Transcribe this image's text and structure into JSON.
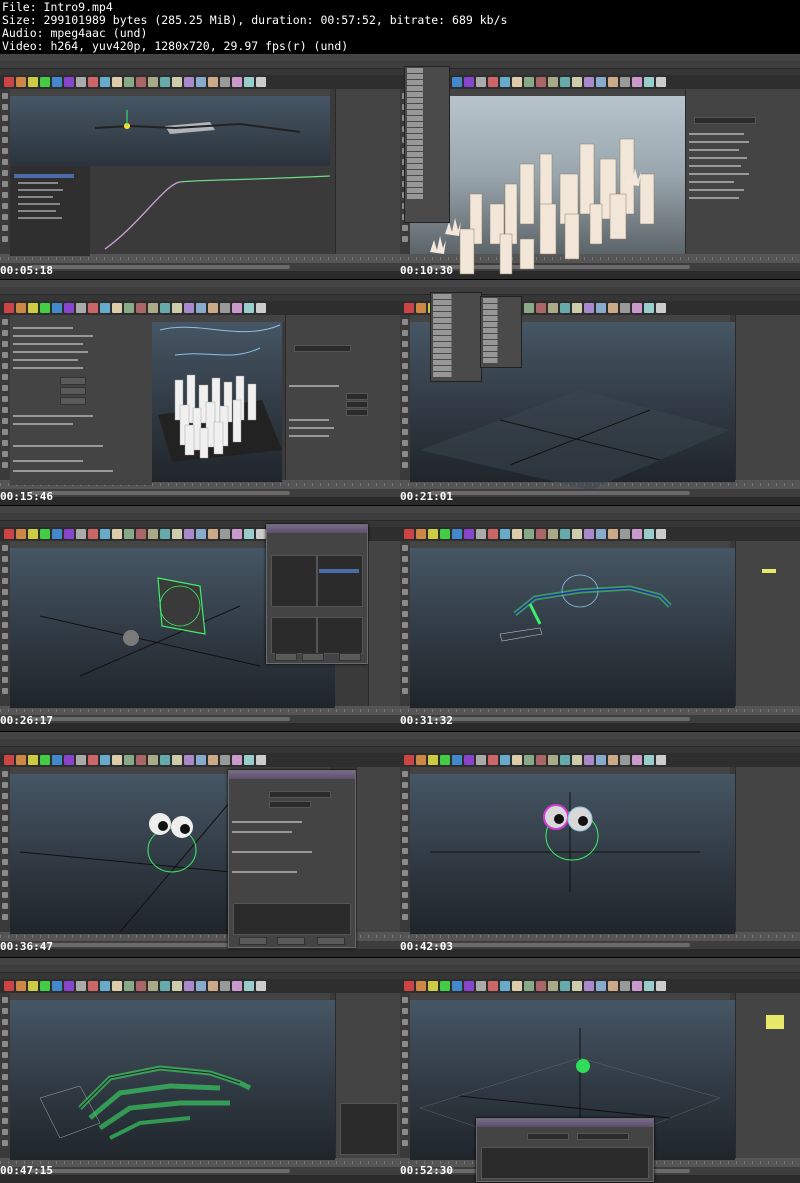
{
  "header": {
    "file": "File: Intro9.mp4",
    "size": "Size: 299101989 bytes (285.25 MiB), duration: 00:57:52, bitrate: 689 kb/s",
    "audio": "Audio: mpeg4aac (und)",
    "video": "Video: h264, yuv420p, 1280x720, 29.97 fps(r) (und)"
  },
  "thumbnails": [
    {
      "timestamp": "00:05:18",
      "scene": "graph-editor-curve"
    },
    {
      "timestamp": "00:10:30",
      "scene": "city-buildings-outliner-menu"
    },
    {
      "timestamp": "00:15:46",
      "scene": "city-motion-path-settings"
    },
    {
      "timestamp": "00:21:01",
      "scene": "create-menu-empty-grid"
    },
    {
      "timestamp": "00:26:17",
      "scene": "plane-sphere-connection-editor"
    },
    {
      "timestamp": "00:31:32",
      "scene": "rigged-arm-ik"
    },
    {
      "timestamp": "00:36:47",
      "scene": "eyeball-sphere-dialog"
    },
    {
      "timestamp": "00:42:03",
      "scene": "eyeballs-textured"
    },
    {
      "timestamp": "00:47:15",
      "scene": "rigged-hand"
    },
    {
      "timestamp": "00:52:30",
      "scene": "grid-sphere-channel-dialog"
    }
  ],
  "colors": {
    "background": "#000000",
    "text": "#ffffff",
    "maya_ui": "#444444",
    "viewport_top": "#465664",
    "viewport_bottom": "#1f252b",
    "selection_green": "#3dff6a",
    "highlight_yellow": "#e8e86a",
    "dialog_title": "#6a5a7a"
  }
}
